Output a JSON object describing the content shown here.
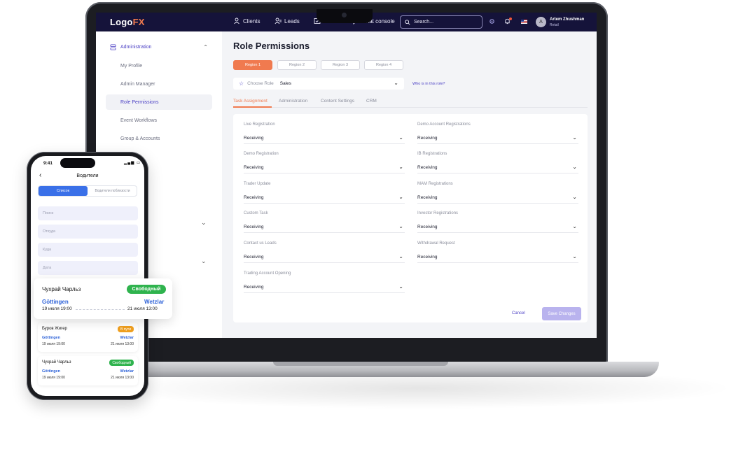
{
  "laptop": {
    "topbar": {
      "logo_main": "Logo",
      "logo_accent": "FX",
      "nav": [
        "Clients",
        "Leads",
        "Tasks",
        "Chat console"
      ],
      "search_placeholder": "Search...",
      "user_name": "Artem Zhushman",
      "user_role": "Retail",
      "avatar_initial": "A",
      "colors": {
        "bar": "#15133a",
        "accent": "#f07a4f",
        "primary": "#4a3fc4"
      }
    },
    "sidebar": {
      "section": "Administration",
      "items": [
        "My Profile",
        "Admin Manager",
        "Role Permissions",
        "Event Workflows",
        "Group & Accounts"
      ],
      "active_item": "Role Permissions"
    },
    "main": {
      "title": "Role Permissions",
      "regions": [
        "Region 1",
        "Region 2",
        "Region 3",
        "Region 4"
      ],
      "choose_role_label": "Choose Role",
      "choose_role_value": "Sales",
      "role_link": "Who is in this role?",
      "tabs": [
        "Task Assignment",
        "Administration",
        "Content Settings",
        "CRM"
      ],
      "active_tab": "Task Assignment",
      "left_fields": [
        {
          "label": "Live Registration",
          "value": "Receiving"
        },
        {
          "label": "Demo Registration",
          "value": "Receiving"
        },
        {
          "label": "Trader Update",
          "value": "Receiving"
        },
        {
          "label": "Custom Task",
          "value": "Receiving"
        },
        {
          "label": "Contact us Leads",
          "value": "Receiving"
        },
        {
          "label": "Trading Account Opening",
          "value": "Receiving"
        }
      ],
      "right_fields": [
        {
          "label": "Demo Account Registrations",
          "value": "Receiving"
        },
        {
          "label": "IB Registrations",
          "value": "Receiving"
        },
        {
          "label": "MAM Registrations",
          "value": "Receiving"
        },
        {
          "label": "Investor Registrations",
          "value": "Receiving"
        },
        {
          "label": "Withdrawal Request",
          "value": "Receiving"
        }
      ],
      "cancel_label": "Cancel",
      "save_label": "Save Changes"
    }
  },
  "phone": {
    "time": "9:41",
    "title": "Водители",
    "segments": [
      "Список",
      "Водители поблизости"
    ],
    "inputs": [
      "Поиск",
      "Откуда",
      "Куда",
      "Дата"
    ],
    "cards": [
      {
        "name": "Буров Жигер",
        "badge": "В пути",
        "from": "Göttingen",
        "to": "Wetzlar",
        "depart": "19 июля 19:00",
        "arrive": "21 июля 13:00",
        "badge_color": "#f0a020"
      },
      {
        "name": "Чухрай Чарльз",
        "badge": "Свободный",
        "from": "Göttingen",
        "to": "Wetzlar",
        "depart": "19 июля 19:00",
        "arrive": "21 июля 13:00",
        "badge_color": "#2fb34e"
      }
    ]
  },
  "popout": {
    "name": "Чухрай Чарльз",
    "badge": "Свободный",
    "from": "Göttingen",
    "to": "Wetzlar",
    "depart": "19 июля 19:00",
    "arrive": "21 июля 13:00"
  }
}
